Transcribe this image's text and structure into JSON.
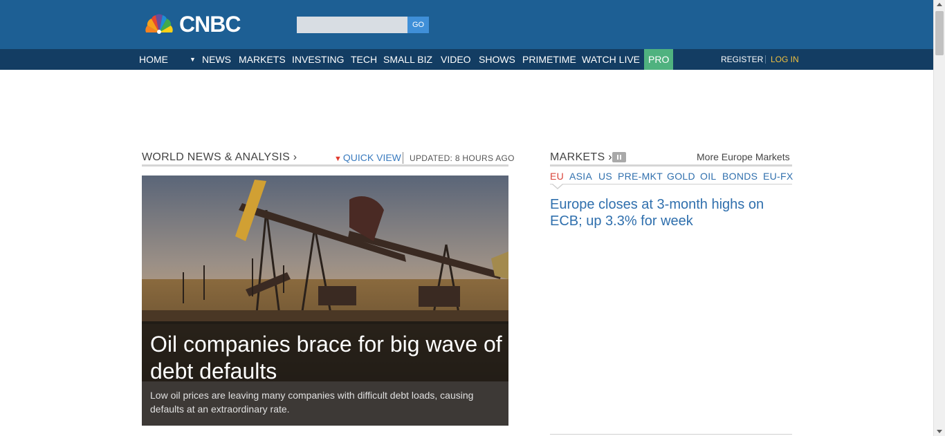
{
  "header": {
    "logo_text": "CNBC",
    "search": {
      "placeholder": "",
      "go_label": "GO"
    }
  },
  "nav": {
    "items": [
      "HOME",
      "▼",
      "NEWS",
      "MARKETS",
      "INVESTING",
      "TECH",
      "SMALL BIZ",
      "VIDEO",
      "SHOWS",
      "PRIMETIME",
      "WATCH LIVE",
      "PRO"
    ],
    "register": "REGISTER",
    "login": "LOG IN"
  },
  "world_news": {
    "title": "WORLD NEWS & ANALYSIS ›",
    "quick_view_arrow": "▼",
    "quick_view": "QUICK VIEW",
    "updated": "UPDATED: 8 HOURS AGO",
    "hero": {
      "headline": "Oil companies brace for big wave of debt defaults",
      "summary": "Low oil prices are leaving many companies with difficult debt loads, causing defaults at an extraordinary rate."
    }
  },
  "markets": {
    "title": "MARKETS ›",
    "more_link": "More Europe Markets",
    "tabs": [
      "EU",
      "ASIA",
      "US",
      "PRE-MKT",
      "GOLD",
      "OIL",
      "BONDS",
      "EU-FX"
    ],
    "active_tab": "EU",
    "headline": "Europe closes at 3-month highs on ECB; up 3.3% for week"
  },
  "colors": {
    "header_bg": "#1d5f94",
    "nav_bg": "#133d63",
    "pro_bg": "#4fb27f",
    "link_blue": "#2f6fad",
    "active_red": "#d9443a",
    "login_gold": "#f0c040"
  }
}
